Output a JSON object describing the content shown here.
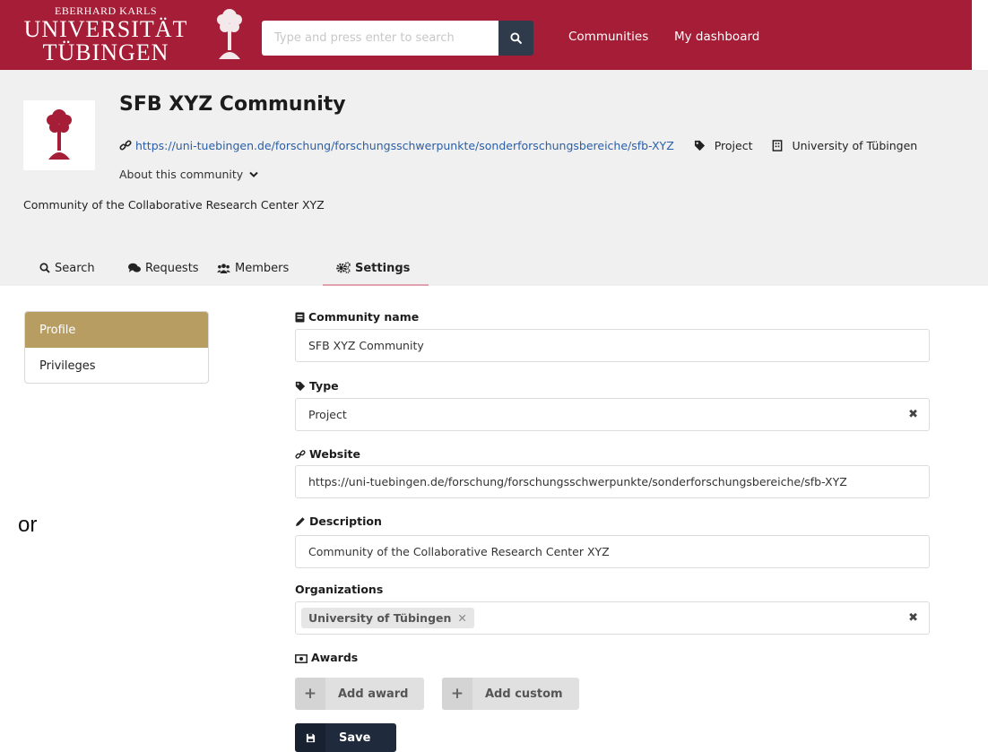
{
  "brand": {
    "line1": "EBERHARD KARLS",
    "line2": "UNIVERSITÄT",
    "line3": "TÜBINGEN"
  },
  "search": {
    "placeholder": "Type and press enter to search"
  },
  "nav": {
    "communities": "Communities",
    "dashboard": "My dashboard"
  },
  "community": {
    "title": "SFB XYZ Community",
    "website": "https://uni-tuebingen.de/forschung/forschungsschwerpunkte/sonderforschungsbereiche/sfb-XYZ",
    "type": "Project",
    "organization": "University of Tübingen",
    "about_toggle": "About this community",
    "description": "Community of the Collaborative Research Center XYZ"
  },
  "tabs": [
    {
      "label": "Search",
      "icon": "search-icon"
    },
    {
      "label": "Requests",
      "icon": "comments-icon"
    },
    {
      "label": "Members",
      "icon": "users-icon"
    },
    {
      "label": "Settings",
      "icon": "cogs-icon",
      "active": true
    }
  ],
  "side_menu": [
    {
      "label": "Profile",
      "active": true
    },
    {
      "label": "Privileges"
    }
  ],
  "cut_text": "or",
  "form": {
    "name_label": "Community name",
    "name_value": "SFB XYZ Community",
    "type_label": "Type",
    "type_value": "Project",
    "website_label": "Website",
    "website_value": "https://uni-tuebingen.de/forschung/forschungsschwerpunkte/sonderforschungsbereiche/sfb-XYZ",
    "description_label": "Description",
    "description_value": "Community of the Collaborative Research Center XYZ",
    "organizations_label": "Organizations",
    "organization_chip": "University of Tübingen",
    "awards_label": "Awards",
    "add_award": "Add award",
    "add_custom": "Add custom",
    "save": "Save"
  },
  "colors": {
    "brand_red": "#a51d36",
    "header_grey": "#f0f0f0",
    "active_menu_gold": "#b79d61",
    "link_blue": "#2a5ea8",
    "save_button": "#1f2a3c"
  }
}
